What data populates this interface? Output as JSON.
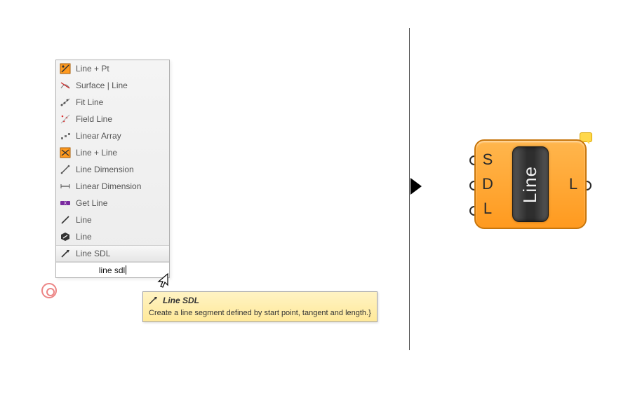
{
  "menu": {
    "items": [
      {
        "label": "Line + Pt",
        "icon": "line-pt-icon"
      },
      {
        "label": "Surface | Line",
        "icon": "surface-line-icon"
      },
      {
        "label": "Fit Line",
        "icon": "fit-line-icon"
      },
      {
        "label": "Field Line",
        "icon": "field-line-icon"
      },
      {
        "label": "Linear Array",
        "icon": "linear-array-icon"
      },
      {
        "label": "Line + Line",
        "icon": "line-line-icon"
      },
      {
        "label": "Line Dimension",
        "icon": "line-dimension-icon"
      },
      {
        "label": "Linear Dimension",
        "icon": "linear-dimension-icon"
      },
      {
        "label": "Get Line",
        "icon": "get-line-icon"
      },
      {
        "label": "Line",
        "icon": "line-icon"
      },
      {
        "label": "Line",
        "icon": "line-hex-icon"
      },
      {
        "label": "Line SDL",
        "icon": "line-sdl-icon"
      }
    ],
    "highlighted_index": 11,
    "search_text": "line sdl"
  },
  "tooltip": {
    "title": "Line SDL",
    "description": "Create a line segment defined by start point, tangent and length.}"
  },
  "component": {
    "name": "Line",
    "inputs": [
      "S",
      "D",
      "L"
    ],
    "outputs": [
      "L"
    ]
  }
}
